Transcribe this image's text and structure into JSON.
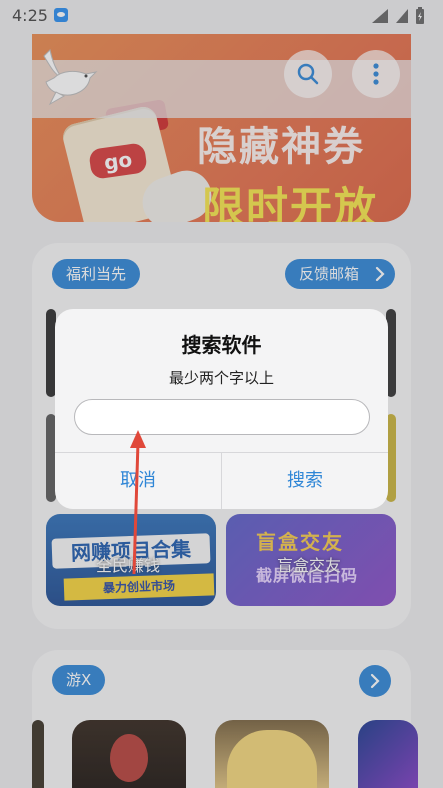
{
  "status_bar": {
    "time": "4:25"
  },
  "banner": {
    "line1": "隐藏神券",
    "line2": "限时开放",
    "go_text": "go"
  },
  "section_welfare": {
    "chip": "福利当先",
    "feedback": "反馈邮箱",
    "tiles": [
      {
        "label": "全民赚钱",
        "art_title": "网赚项目合集",
        "art_sub": "暴力创业市场"
      },
      {
        "label": "盲盒交友",
        "art_title": "盲盒交友",
        "art_sub": "截屏微信扫码"
      }
    ]
  },
  "section_games": {
    "chip": "游X"
  },
  "dialog": {
    "title": "搜索软件",
    "message": "最少两个字以上",
    "input_value": "",
    "input_placeholder": "",
    "cancel_label": "取消",
    "confirm_label": "搜索"
  },
  "colors": {
    "accent": "#2f86d6",
    "annotation_arrow": "#e0483a"
  }
}
